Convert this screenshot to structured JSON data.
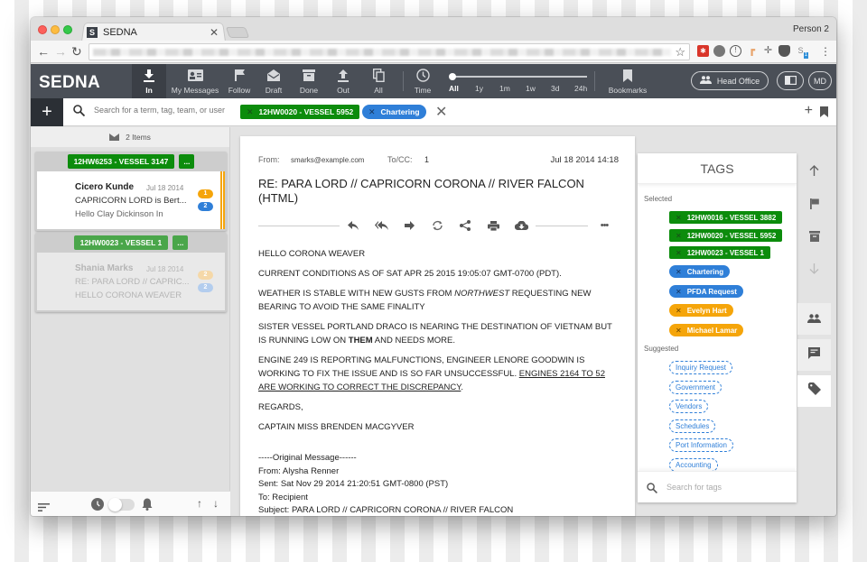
{
  "browser": {
    "tab_title": "SEDNA",
    "favicon_letter": "S",
    "profile": "Person 2",
    "extension_badge": "1"
  },
  "app": {
    "logo": "SEDNA",
    "nav": [
      {
        "label": "In",
        "icon": "inbox-download-icon",
        "active": true
      },
      {
        "label": "My Messages",
        "icon": "contact-card-icon",
        "active": false
      },
      {
        "label": "Follow",
        "icon": "flag-icon",
        "active": false
      },
      {
        "label": "Draft",
        "icon": "open-envelope-icon",
        "active": false
      },
      {
        "label": "Done",
        "icon": "archive-icon",
        "active": false
      },
      {
        "label": "Out",
        "icon": "upload-icon",
        "active": false
      },
      {
        "label": "All",
        "icon": "copy-icon",
        "active": false
      }
    ],
    "time_label": "Time",
    "time_ranges": [
      "All",
      "1y",
      "1m",
      "1w",
      "3d",
      "24h"
    ],
    "time_selected": "All",
    "bookmarks_label": "Bookmarks",
    "team_button": "Head Office",
    "user_initials": "MD"
  },
  "search": {
    "placeholder": "Search for a term, tag, team, or user",
    "value": "",
    "chips": [
      {
        "label": "12HW0020 - VESSEL 5952",
        "color": "#0c8c0c",
        "kind": "vessel"
      },
      {
        "label": "Chartering",
        "color": "#2f7fd8",
        "kind": "topic"
      }
    ]
  },
  "list": {
    "count_label": "2 Items",
    "groups": [
      {
        "tag": "12HW6253 - VESSEL 3147",
        "more": "...",
        "message": {
          "sender": "Cicero Kunde",
          "date": "Jul 18 2014",
          "subject": "CAPRICORN LORD is Bert...",
          "preview": "Hello Clay Dickinson In",
          "badges": [
            "1",
            "2"
          ],
          "selected": true
        }
      },
      {
        "tag": "12HW0023 - VESSEL 1",
        "more": "...",
        "message": {
          "sender": "Shania Marks",
          "date": "Jul 18 2014",
          "subject": "RE: PARA LORD // CAPRIC...",
          "preview": "HELLO CORONA WEAVER",
          "badges": [
            "2",
            "2"
          ],
          "selected": false
        }
      }
    ],
    "toggle_on": false
  },
  "message": {
    "from_label": "From:",
    "from": "smarks@example.com",
    "tocc_label": "To/CC:",
    "tocc": "1",
    "date": "Jul 18 2014 14:18",
    "title": "RE: PARA LORD // CAPRICORN CORONA // RIVER FALCON (HTML)",
    "body": {
      "greeting": "HELLO CORONA WEAVER",
      "p1": "CURRENT CONDITIONS AS OF SAT APR 25 2015 19:05:07 GMT-0700 (PDT).",
      "p2_a": "WEATHER IS STABLE WITH NEW GUSTS FROM ",
      "p2_em": "NORTHWEST",
      "p2_b": " REQUESTING NEW BEARING TO AVOID THE SAME FINALITY",
      "p3_a": "SISTER VESSEL PORTLAND DRACO IS NEARING THE DESTINATION OF VIETNAM BUT IS RUNNING LOW ON ",
      "p3_strong": "THEM",
      "p3_b": " AND NEEDS MORE.",
      "p4_a": "ENGINE 249 IS REPORTING MALFUNCTIONS, ENGINEER LENORE GOODWIN IS WORKING TO FIX THE ISSUE AND IS SO FAR UNSUCCESSFUL. ",
      "p4_u": "ENGINES 2164 TO 52 ARE WORKING TO CORRECT THE DISCREPANCY",
      "p4_b": ".",
      "regards": "REGARDS,",
      "signature": "CAPTAIN MISS BRENDEN MACGYVER",
      "original": [
        "-----Original Message------",
        "From: Alysha Renner",
        "Sent: Sat Nov 29 2014 21:20:51 GMT-0800 (PST)",
        "To: Recipient",
        "Subject: PARA LORD // CAPRICORN CORONA // RIVER FALCON"
      ]
    }
  },
  "tags": {
    "title": "TAGS",
    "selected_label": "Selected",
    "selected": [
      {
        "label": "12HW0016 - VESSEL 3882",
        "kind": "green"
      },
      {
        "label": "12HW0020 - VESSEL 5952",
        "kind": "green"
      },
      {
        "label": "12HW0023 - VESSEL 1",
        "kind": "green"
      },
      {
        "label": "Chartering",
        "kind": "blue"
      },
      {
        "label": "PFDA Request",
        "kind": "blue"
      },
      {
        "label": "Evelyn Hart",
        "kind": "orange"
      },
      {
        "label": "Michael Lamar",
        "kind": "orange"
      }
    ],
    "suggested_label": "Suggested",
    "suggested": [
      "Inquiry Request",
      "Government",
      "Vendors",
      "Schedules",
      "Port Information",
      "Accounting"
    ],
    "search_placeholder": "Search for tags"
  },
  "colors": {
    "header": "#4a4f57",
    "vessel_green": "#0c8c0c",
    "topic_blue": "#2f7fd8",
    "person_orange": "#f5a50a"
  }
}
